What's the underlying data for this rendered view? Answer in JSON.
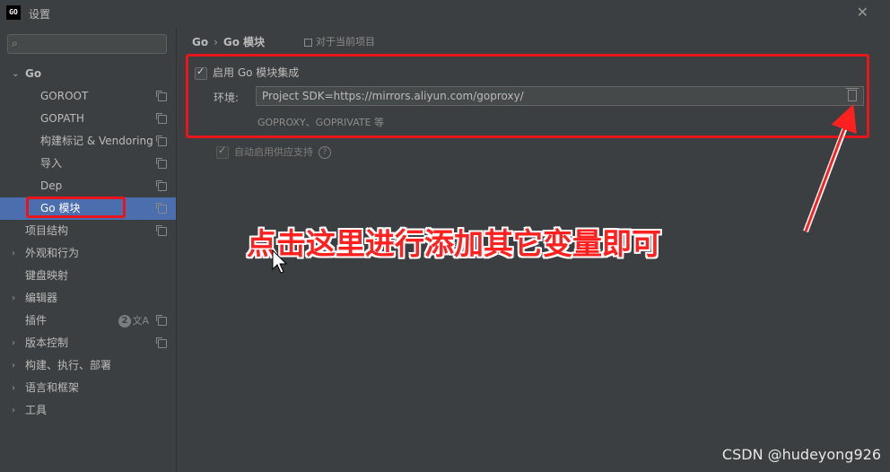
{
  "window": {
    "logo": "GO",
    "title": "设置"
  },
  "sidebar": {
    "search_placeholder": "",
    "group_go": {
      "label": "Go"
    },
    "go_children": [
      {
        "label": "GOROOT"
      },
      {
        "label": "GOPATH"
      },
      {
        "label": "构建标记 & Vendoring"
      },
      {
        "label": "导入"
      },
      {
        "label": "Dep"
      },
      {
        "label": "Go 模块"
      }
    ],
    "items": [
      {
        "label": "项目结构"
      },
      {
        "label": "外观和行为"
      },
      {
        "label": "键盘映射"
      },
      {
        "label": "编辑器"
      },
      {
        "label": "插件",
        "badge": "2"
      },
      {
        "label": "版本控制"
      },
      {
        "label": "构建、执行、部署"
      },
      {
        "label": "语言和框架"
      },
      {
        "label": "工具"
      }
    ]
  },
  "main": {
    "breadcrumb": {
      "root": "Go",
      "sep": "›",
      "current": "Go 模块"
    },
    "project_scope": "对于当前项目",
    "enable_integration": {
      "label": "启用 Go 模块集成",
      "checked": true
    },
    "environment": {
      "label": "环境:",
      "value": "Project SDK=https://mirrors.aliyun.com/goproxy/",
      "hint": "GOPROXY、GOPRIVATE 等"
    },
    "vendoring": {
      "label": "自动启用供应支持",
      "help": "?"
    }
  },
  "annotation": {
    "text": "点击这里进行添加其它变量即可",
    "color": "#ff2020"
  },
  "watermark": "CSDN @hudeyong926",
  "colors": {
    "selection": "#4b6eaf",
    "background": "#3c3f41",
    "highlight_red": "#e8151b"
  }
}
